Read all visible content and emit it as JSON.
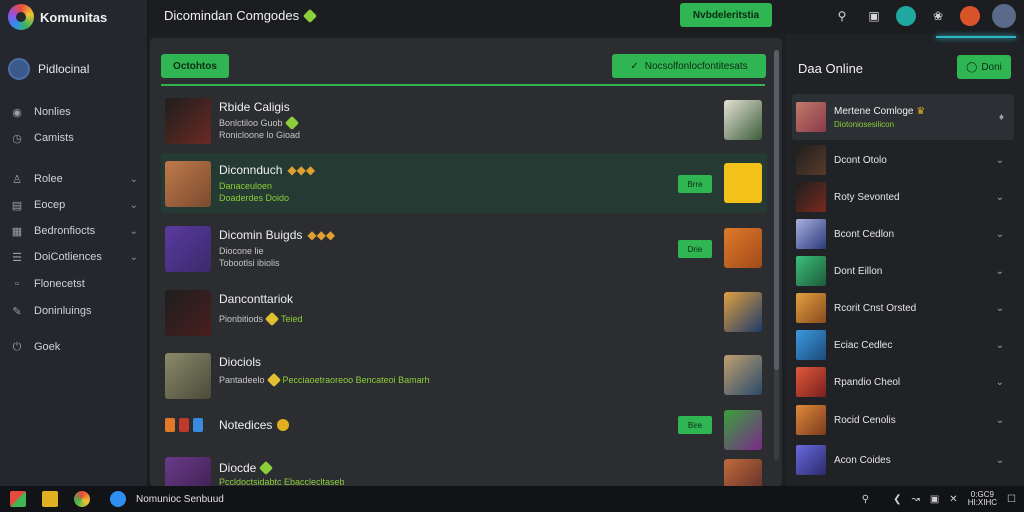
{
  "app": {
    "name": "Komunitas",
    "page_title": "Dicomindan Comgodes"
  },
  "header": {
    "cta_label": "Nvbdeleritstia",
    "icons": [
      "search-icon",
      "camera-icon",
      "status-icon",
      "settings-icon",
      "notification-avatar",
      "user-avatar"
    ]
  },
  "sidebar": {
    "profile_label": "Pidlocinal",
    "items": [
      {
        "label": "Nonlies",
        "icon": "people-icon",
        "chevron": false
      },
      {
        "label": "Camists",
        "icon": "clock-icon",
        "chevron": false
      },
      {
        "label": "Rolee",
        "icon": "user-plus-icon",
        "chevron": true
      },
      {
        "label": "Eocep",
        "icon": "book-icon",
        "chevron": true
      },
      {
        "label": "Bedronfiocts",
        "icon": "grid-icon",
        "chevron": true
      },
      {
        "label": "DoiCotliences",
        "icon": "list-icon",
        "chevron": true
      },
      {
        "label": "Flonecetst",
        "icon": "file-icon",
        "chevron": false
      },
      {
        "label": "Doninluings",
        "icon": "pen-icon",
        "chevron": false
      },
      {
        "label": "Goek",
        "icon": "power-icon",
        "chevron": false
      }
    ]
  },
  "main": {
    "tab_label": "Octohtos",
    "action_label": "Nocsolfonlocfontitesats",
    "rows": [
      {
        "name": "Rbide Caligis",
        "line1": "Bonlctiloo Guob",
        "line2": "Ronicloone lo Gioad",
        "button": "",
        "thumb": "#6b2a22",
        "art": "#3b5e3a",
        "active": false
      },
      {
        "name": "Diconnduch",
        "line1": "Danaceuloen",
        "line2": "Doaderdes Doido",
        "button": "Brre",
        "thumb": "#7a4a30",
        "art": "#f2c21a",
        "active": true
      },
      {
        "name": "Dicomin Buigds",
        "line1": "Diocone lie",
        "line2": "Tobootlsi ibiolis",
        "button": "Drie",
        "thumb": "#3a2a6b",
        "art": "#a04a1a",
        "active": false
      },
      {
        "name": "Danconttariok",
        "line1": "Pionbitiods",
        "line2": "",
        "green": "Teied",
        "button": "",
        "thumb": "#4a1e1e",
        "art": "#1e3a6a",
        "active": false
      },
      {
        "name": "Diociols",
        "line1": "Pantadeelo",
        "line2": "",
        "green": "Pecciaoetraoreoo Bencateoi Bamarh",
        "button": "",
        "thumb": "#4a4a3a",
        "art": "#2a4a6a",
        "active": false
      },
      {
        "name": "Notedices",
        "line1": "",
        "line2": "",
        "button": "Bire",
        "thumb": "#1e1e1e",
        "art": "#2a6a2a",
        "active": false
      },
      {
        "name": "Diocde",
        "line1": "",
        "line2": "",
        "green": "Pccldoctsidabtc Ebacclecltaseb",
        "button": "",
        "thumb": "#3a1e4a",
        "art": "#5a2a2a",
        "active": false
      }
    ]
  },
  "right_panel": {
    "title": "Daa Online",
    "button_label": "Doni",
    "users": [
      {
        "name": "Mertene Comloge",
        "status": "Diotoniosesilicon",
        "color": "#8a3a4a",
        "selected": true
      },
      {
        "name": "Dcont Otolo",
        "status": "",
        "color": "#5a3a2a",
        "selected": false
      },
      {
        "name": "Roty Sevonted",
        "status": "",
        "color": "#7a2a1e",
        "selected": false
      },
      {
        "name": "Bcont Cedlon",
        "status": "",
        "color": "#2a3a7a",
        "selected": false
      },
      {
        "name": "Dont Eillon",
        "status": "",
        "color": "#1e5a3a",
        "selected": false
      },
      {
        "name": "Rcorit Cnst Orsted",
        "status": "",
        "color": "#8a4a1e",
        "selected": false
      },
      {
        "name": "Eciac Cedlec",
        "status": "",
        "color": "#1e4a7a",
        "selected": false
      },
      {
        "name": "Rpandio Cheol",
        "status": "",
        "color": "#7a1e1e",
        "selected": false
      },
      {
        "name": "Rocid Cenolis",
        "status": "",
        "color": "#7a3a1e",
        "selected": false
      },
      {
        "name": "Acon Coides",
        "status": "",
        "color": "#2a2a6a",
        "selected": false
      }
    ]
  },
  "taskbar": {
    "label": "Nomunioc Senbuud",
    "clock_time": "0:GC9",
    "clock_date": "HI:XIHC"
  },
  "colors": {
    "accent": "#2fb653",
    "panel": "#2b2d31",
    "sidebar": "#24272d"
  }
}
